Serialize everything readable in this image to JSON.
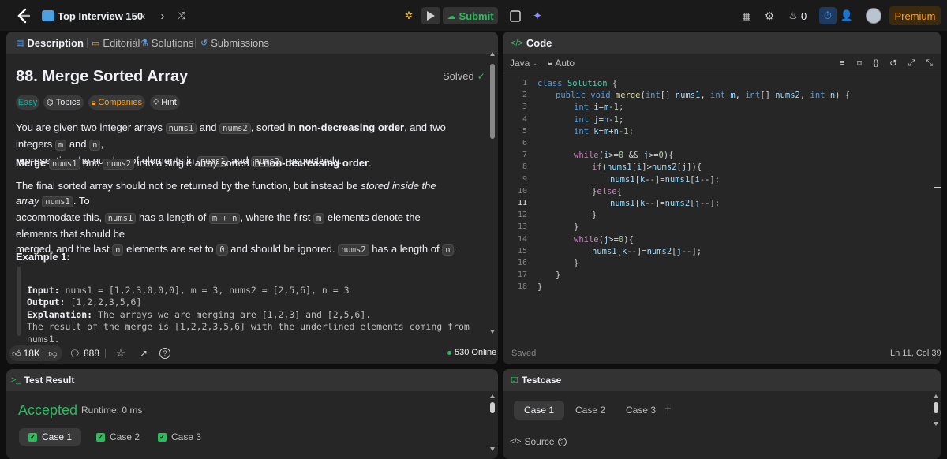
{
  "topbar": {
    "problem_list": "Top Interview 150",
    "submit": "Submit",
    "streak_count": "0",
    "premium": "Premium",
    "accent": "#ffa116",
    "success": "#2cbb5d"
  },
  "left_tabs": {
    "description": "Description",
    "editorial": "Editorial",
    "solutions": "Solutions",
    "submissions": "Submissions"
  },
  "problem": {
    "title": "88. Merge Sorted Array",
    "status": "Solved",
    "difficulty": "Easy",
    "topics": "Topics",
    "companies": "Companies",
    "hint": "Hint",
    "p1": {
      "a": "You are given two integer arrays ",
      "nums1": "nums1",
      "and1": " and ",
      "nums2": "nums2",
      "b": ", sorted in ",
      "bold": "non-decreasing order",
      "c": ", and two integers ",
      "m": "m",
      "and2": " and ",
      "n": "n",
      "d": ",",
      "e": "representing the number of elements in ",
      "nums1b": "nums1",
      "and3": " and ",
      "nums2b": "nums2",
      "f": " respectively."
    },
    "p2": {
      "merge": "Merge",
      "nums1": "nums1",
      "and": "and",
      "nums2": "nums2",
      "a": "into a single array sorted in",
      "bold": "non-decreasing order",
      "dot": "."
    },
    "p3": {
      "a": "The final sorted array should not be returned by the function, but instead be ",
      "italic": "stored inside the array",
      "nums1": "nums1",
      "b": ". To",
      "c": "accommodate this, ",
      "nums1b": "nums1",
      "d": " has a length of ",
      "mn": "m + n",
      "e": ", where the first ",
      "m": "m",
      "f": " elements denote the elements that should be",
      "g": "merged, and the last ",
      "n": "n",
      "h": " elements are set to ",
      "zero": "0",
      "i": " and should be ignored. ",
      "nums2": "nums2",
      "j": " has a length of ",
      "n2": "n",
      "k": "."
    },
    "example_title": "Example 1:",
    "example": {
      "input_label": "Input:",
      "input": " nums1 = [1,2,3,0,0,0], m = 3, nums2 = [2,5,6], n = 3",
      "output_label": "Output:",
      "output": " [1,2,2,3,5,6]",
      "explanation_label": "Explanation:",
      "explanation": " The arrays we are merging are [1,2,3] and [2,5,6].",
      "explanation2": "The result of the merge is [1,2,2,3,5,6] with the underlined elements coming from",
      "explanation3": "nums1."
    },
    "likes": "18K",
    "comments": "888",
    "online": "530 Online"
  },
  "code": {
    "title": "Code",
    "language": "Java",
    "mode": "Auto",
    "lines": [
      {
        "n": "1",
        "html": "<span class=\"kw\">class</span> <span class=\"ty\">Solution</span> {",
        "indent": 0
      },
      {
        "n": "2",
        "html": "<span class=\"kw\">public</span> <span class=\"kw\">void</span> <span class=\"fn\">merge</span>(<span class=\"kw\">int</span>[] <span class=\"vr\">nums1</span>, <span class=\"kw\">int</span> <span class=\"vr\">m</span>, <span class=\"kw\">int</span>[] <span class=\"vr\">nums2</span>, <span class=\"kw\">int</span> <span class=\"vr\">n</span>) {",
        "indent": 1
      },
      {
        "n": "3",
        "html": "<span class=\"kw\">int</span> <span class=\"vr\">i</span>=<span class=\"vr\">m</span>-<span class=\"nm\">1</span>;",
        "indent": 2
      },
      {
        "n": "4",
        "html": "<span class=\"kw\">int</span> <span class=\"vr\">j</span>=<span class=\"vr\">n</span>-<span class=\"nm\">1</span>;",
        "indent": 2
      },
      {
        "n": "5",
        "html": "<span class=\"kw\">int</span> <span class=\"vr\">k</span>=<span class=\"vr\">m</span>+<span class=\"vr\">n</span>-<span class=\"nm\">1</span>;",
        "indent": 2
      },
      {
        "n": "6",
        "html": "",
        "indent": 2
      },
      {
        "n": "7",
        "html": "<span class=\"ctl\">while</span>(<span class=\"vr\">i</span>&gt;=<span class=\"nm\">0</span> &amp;&amp; <span class=\"vr\">j</span>&gt;=<span class=\"nm\">0</span>){",
        "indent": 2
      },
      {
        "n": "8",
        "html": "<span class=\"ctl\">if</span>(<span class=\"vr\">nums1</span>[<span class=\"vr\">i</span>]&gt;<span class=\"vr\">nums2</span>[<span class=\"vr\">j</span>]){",
        "indent": 3
      },
      {
        "n": "9",
        "html": "<span class=\"vr\">nums1</span>[<span class=\"vr\">k</span>--]=<span class=\"vr\">nums1</span>[<span class=\"vr\">i</span>--];",
        "indent": 4
      },
      {
        "n": "10",
        "html": "}<span class=\"ctl\">else</span>{",
        "indent": 3
      },
      {
        "n": "11",
        "html": "<span class=\"vr\">nums1</span>[<span class=\"vr\">k</span>--]=<span class=\"vr\">nums2</span>[<span class=\"vr\">j</span>--];",
        "indent": 4
      },
      {
        "n": "12",
        "html": "}",
        "indent": 3
      },
      {
        "n": "13",
        "html": "}",
        "indent": 2
      },
      {
        "n": "14",
        "html": "<span class=\"ctl\">while</span>(<span class=\"vr\">j</span>&gt;=<span class=\"nm\">0</span>){",
        "indent": 2
      },
      {
        "n": "15",
        "html": "<span class=\"vr\">nums1</span>[<span class=\"vr\">k</span>--]=<span class=\"vr\">nums2</span>[<span class=\"vr\">j</span>--];",
        "indent": 3
      },
      {
        "n": "16",
        "html": "}",
        "indent": 2
      },
      {
        "n": "17",
        "html": "}",
        "indent": 1
      },
      {
        "n": "18",
        "html": "}",
        "indent": 0
      }
    ],
    "saved": "Saved",
    "cursor": "Ln 11, Col 39"
  },
  "result": {
    "title": "Test Result",
    "status": "Accepted",
    "runtime": "Runtime: 0 ms",
    "cases": [
      "Case 1",
      "Case 2",
      "Case 3"
    ]
  },
  "testcase": {
    "title": "Testcase",
    "cases": [
      "Case 1",
      "Case 2",
      "Case 3"
    ],
    "add": "+",
    "source": "Source"
  }
}
